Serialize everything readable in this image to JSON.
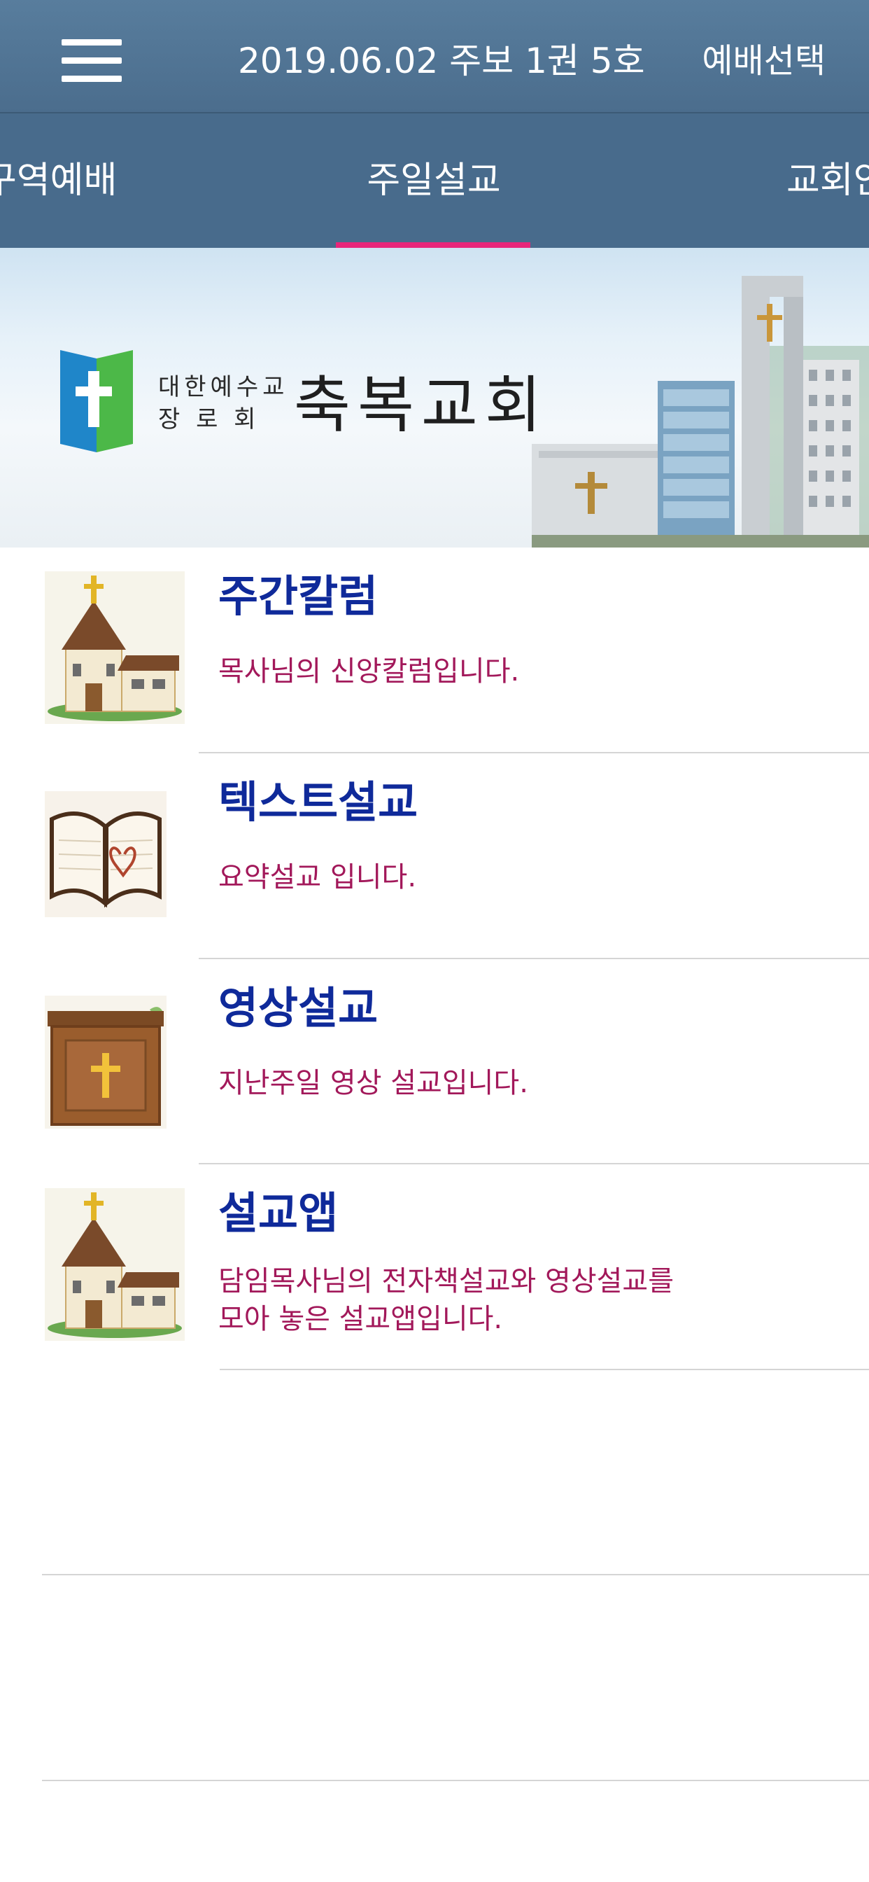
{
  "header": {
    "title": "2019.06.02 주보 1권 5호",
    "action_label": "예배선택",
    "menu_icon": "hamburger-icon"
  },
  "tabs": [
    {
      "label": "구역예배",
      "active": false
    },
    {
      "label": "주일설교",
      "active": true
    },
    {
      "label": "교회안내",
      "active": false
    }
  ],
  "colors": {
    "header": "#587d9d",
    "tabbar": "#486b8c",
    "tab_indicator": "#e8257a",
    "item_title": "#0f2a9a",
    "item_desc": "#a2185a"
  },
  "banner": {
    "logo_small_line1": "대한예수교",
    "logo_small_line2": "장 로 회",
    "church_name": "축복교회"
  },
  "items": [
    {
      "title": "주간칼럼",
      "desc": "목사님의 신앙칼럼입니다.",
      "icon": "church-icon"
    },
    {
      "title": "텍스트설교",
      "desc": "요약설교 입니다.",
      "icon": "bible-icon"
    },
    {
      "title": "영상설교",
      "desc": "지난주일 영상 설교입니다.",
      "icon": "pulpit-icon"
    },
    {
      "title": "설교앱",
      "desc_line1": "담임목사님의 전자책설교와 영상설교를",
      "desc_line2": "모아 놓은 설교앱입니다.",
      "icon": "church-icon"
    }
  ]
}
